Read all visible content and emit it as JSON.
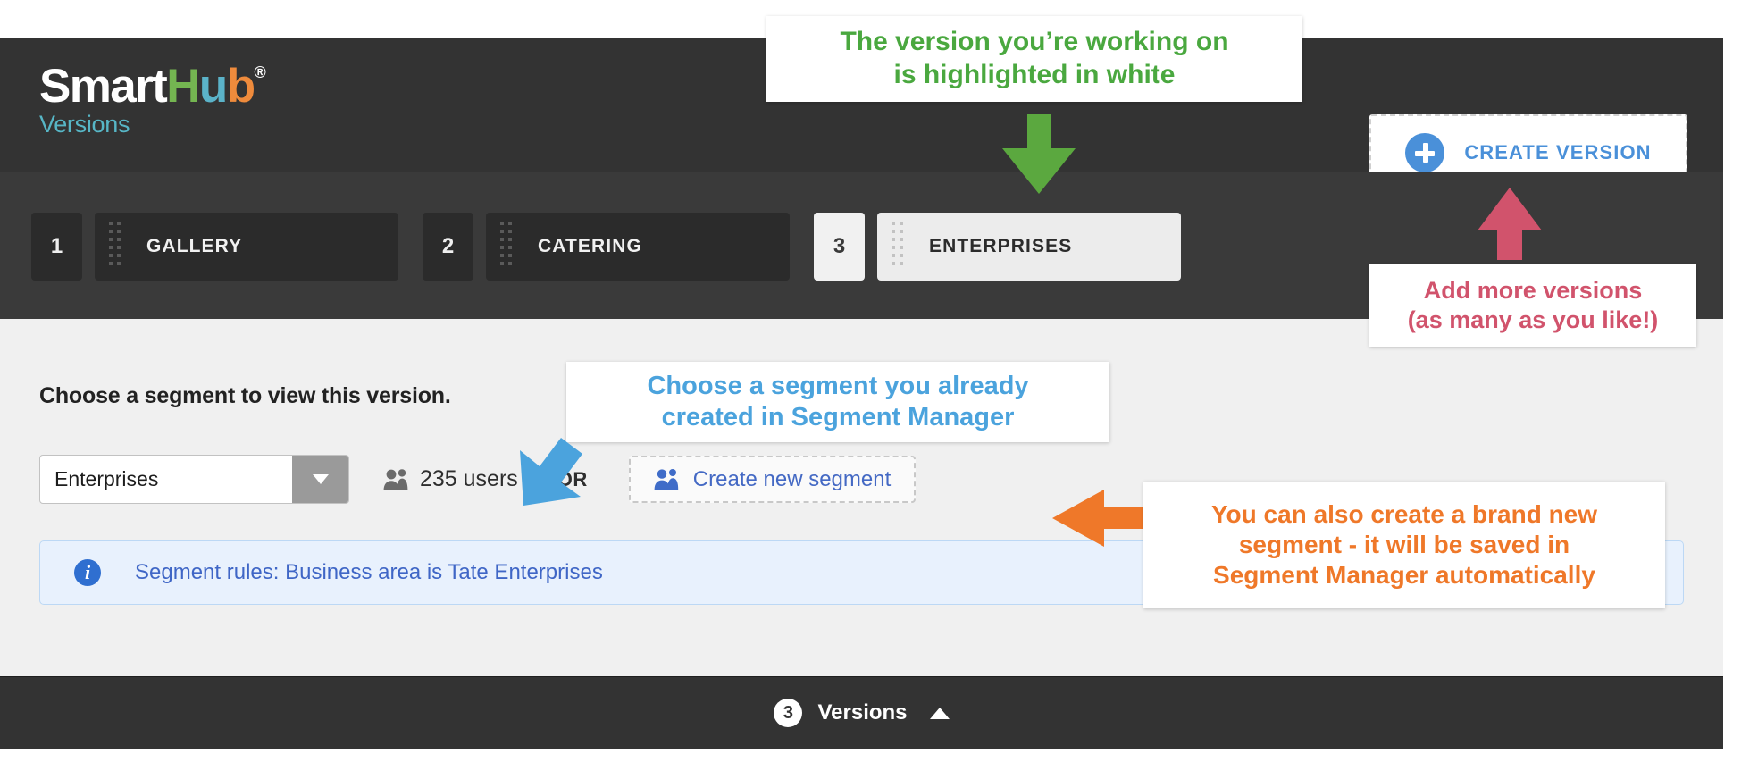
{
  "app": {
    "logo": {
      "part1": "Smart",
      "part2": "H",
      "part3": "u",
      "part4": "b",
      "trademark": "®"
    },
    "subtitle": "Versions"
  },
  "header": {
    "create_version_label": "CREATE VERSION",
    "plus_icon": "plus-circle-icon"
  },
  "versions": {
    "items": [
      {
        "number": "1",
        "label": "GALLERY",
        "active": false
      },
      {
        "number": "2",
        "label": "CATERING",
        "active": false
      },
      {
        "number": "3",
        "label": "ENTERPRISES",
        "active": true
      }
    ]
  },
  "main": {
    "title": "Choose a segment to view this version.",
    "segment_select": {
      "value": "Enterprises"
    },
    "users_count": "235 users",
    "or_text": "OR",
    "create_segment_label": "Create new segment",
    "info": {
      "icon": "info-circle-icon",
      "text": "Segment rules: Business area is Tate Enterprises"
    }
  },
  "footer": {
    "count": "3",
    "label": "Versions",
    "chevron": "chevron-up-icon"
  },
  "annotations": [
    {
      "id": "green",
      "line1": "The version you’re working on",
      "line2": "is highlighted in white",
      "color": "#4aa83f",
      "arrow": "arrow-down"
    },
    {
      "id": "pink",
      "line1": "Add more versions",
      "line2": "(as many as you like!)",
      "color": "#d1536c",
      "arrow": "arrow-up"
    },
    {
      "id": "blue",
      "line1": "Choose a segment you already",
      "line2": "created in Segment Manager",
      "color": "#4ba3dd",
      "arrow": "arrow-diagonal-down-left"
    },
    {
      "id": "orange",
      "line1": "You can also create a brand new",
      "line2": "segment - it will be saved in",
      "line3": "Segment Manager automatically",
      "color": "#ef7829",
      "arrow": "arrow-left"
    }
  ],
  "colors": {
    "header_bg": "#333333",
    "strip_bg": "#3a3a3a",
    "content_bg": "#f0f0f0",
    "accent_blue": "#4a90d9",
    "link_blue": "#4469c4",
    "info_bg": "#e8f1fd",
    "logo_green": "#74b551",
    "logo_teal": "#5bb3c9",
    "logo_orange": "#ef8b3c"
  }
}
